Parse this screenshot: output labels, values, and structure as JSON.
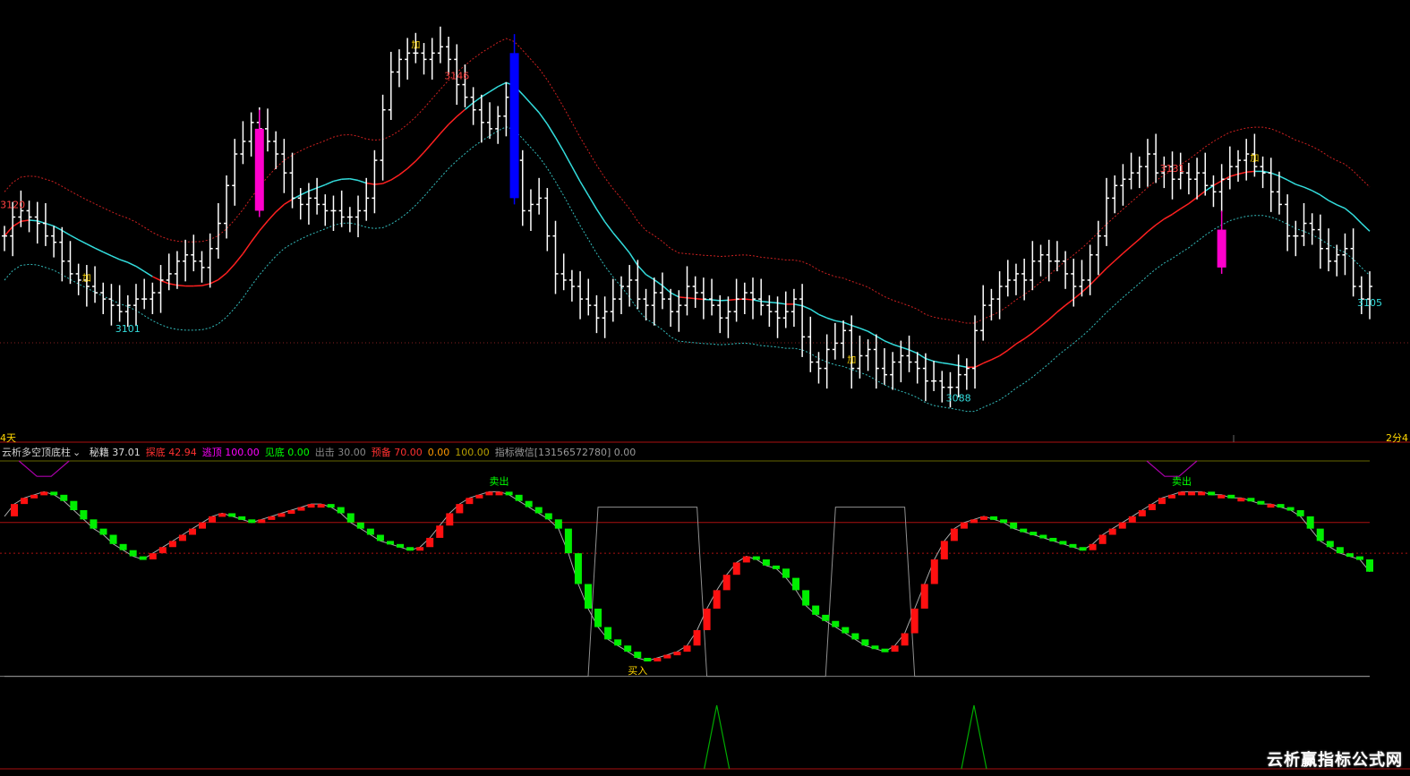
{
  "footer": {
    "watermark": "云析赢指标公式网",
    "period_left": "4天",
    "period_right": "2分4"
  },
  "indicator_header": {
    "name": "云析多空顶底柱",
    "items": [
      {
        "label": "秘籍",
        "value": "37.01",
        "color": "#dddddd"
      },
      {
        "label": "探底",
        "value": "42.94",
        "color": "#ff3030"
      },
      {
        "label": "逃顶",
        "value": "100.00",
        "color": "#ff00ff"
      },
      {
        "label": "见底",
        "value": "0.00",
        "color": "#00ff00"
      },
      {
        "label": "出击",
        "value": "30.00",
        "color": "#888888"
      },
      {
        "label": "预备",
        "value": "70.00",
        "color": "#ff3030"
      },
      {
        "label": "",
        "value": "0.00",
        "color": "#ff9900"
      },
      {
        "label": "",
        "value": "100.00",
        "color": "#b8a000"
      },
      {
        "label": "指标微信[13156572780]",
        "value": "0.00",
        "color": "#999999"
      }
    ]
  },
  "colors": {
    "background": "#000000",
    "bar": "#ffffff",
    "mid_up": "#ff2020",
    "mid_down": "#33dddd",
    "upper_band": "#cc2020",
    "lower_band": "#33bbbb",
    "osc_up": "#ff1010",
    "osc_down": "#00ee00",
    "big_bull": "#ff00cc",
    "big_bear": "#0000ff",
    "signal_top": "#aa00aa",
    "signal_bottom": "#00aa00",
    "grey": "#909090"
  },
  "chart_data": [
    {
      "type": "ohlc",
      "price_labels": [
        {
          "text": "3146",
          "color": "#ff4040"
        },
        {
          "text": "3120",
          "color": "#ff4040"
        },
        {
          "text": "3101",
          "color": "#33dddd"
        },
        {
          "text": "3131",
          "color": "#ff4040"
        },
        {
          "text": "3088",
          "color": "#33dddd"
        },
        {
          "text": "3105",
          "color": "#33dddd"
        }
      ],
      "markers": [
        "加",
        "加",
        "加",
        "加"
      ],
      "close": [
        3114,
        3117,
        3118,
        3117,
        3116,
        3114,
        3113,
        3110,
        3108,
        3107,
        3106,
        3105,
        3104,
        3103,
        3102,
        3103,
        3104,
        3104,
        3105,
        3107,
        3108,
        3110,
        3111,
        3110,
        3109,
        3112,
        3116,
        3122,
        3127,
        3129,
        3132,
        3131,
        3129,
        3127,
        3124,
        3120,
        3119,
        3120,
        3119,
        3118,
        3118,
        3117,
        3117,
        3118,
        3120,
        3126,
        3134,
        3140,
        3142,
        3143,
        3143,
        3142,
        3143,
        3144,
        3142,
        3138,
        3136,
        3134,
        3132,
        3131,
        3133,
        3136,
        3126,
        3118,
        3119,
        3120,
        3114,
        3108,
        3107,
        3106,
        3104,
        3103,
        3101,
        3102,
        3104,
        3106,
        3107,
        3104,
        3103,
        3105,
        3104,
        3102,
        3103,
        3106,
        3105,
        3104,
        3103,
        3101,
        3102,
        3104,
        3105,
        3104,
        3103,
        3102,
        3101,
        3102,
        3104,
        3098,
        3094,
        3093,
        3096,
        3097,
        3099,
        3093,
        3095,
        3096,
        3093,
        3092,
        3094,
        3095,
        3094,
        3093,
        3091,
        3091,
        3090,
        3090,
        3092,
        3093,
        3099,
        3103,
        3104,
        3106,
        3107,
        3108,
        3107,
        3110,
        3111,
        3110,
        3110,
        3108,
        3106,
        3107,
        3111,
        3114,
        3120,
        3122,
        3123,
        3124,
        3125,
        3127,
        3124,
        3125,
        3123,
        3124,
        3123,
        3124,
        3122,
        3121,
        3123,
        3125,
        3126,
        3127,
        3125,
        3124,
        3121,
        3119,
        3114,
        3114,
        3116,
        3115,
        3112,
        3110,
        3111,
        3112,
        3106,
        3104,
        3106
      ]
    },
    {
      "type": "oscillator",
      "value": [
        82,
        86,
        88,
        89,
        90,
        89,
        87,
        84,
        81,
        78,
        76,
        73,
        71,
        69,
        68,
        70,
        72,
        74,
        76,
        78,
        80,
        82,
        83,
        82,
        81,
        80,
        81,
        82,
        83,
        84,
        85,
        86,
        86,
        85,
        83,
        80,
        78,
        76,
        74,
        73,
        72,
        71,
        72,
        75,
        79,
        83,
        86,
        88,
        89,
        90,
        90,
        89,
        87,
        85,
        83,
        81,
        78,
        70,
        60,
        52,
        46,
        42,
        40,
        38,
        36,
        35,
        36,
        37,
        38,
        40,
        45,
        52,
        58,
        63,
        67,
        69,
        68,
        66,
        65,
        62,
        58,
        53,
        50,
        48,
        46,
        44,
        42,
        40,
        39,
        38,
        40,
        44,
        52,
        60,
        68,
        74,
        78,
        80,
        81,
        82,
        81,
        80,
        78,
        77,
        76,
        75,
        74,
        73,
        72,
        71,
        73,
        76,
        78,
        80,
        82,
        84,
        86,
        88,
        89,
        90,
        90,
        90,
        89,
        89,
        88,
        88,
        87,
        86,
        86,
        85,
        84,
        82,
        78,
        74,
        72,
        70,
        69,
        68,
        64
      ]
    }
  ]
}
